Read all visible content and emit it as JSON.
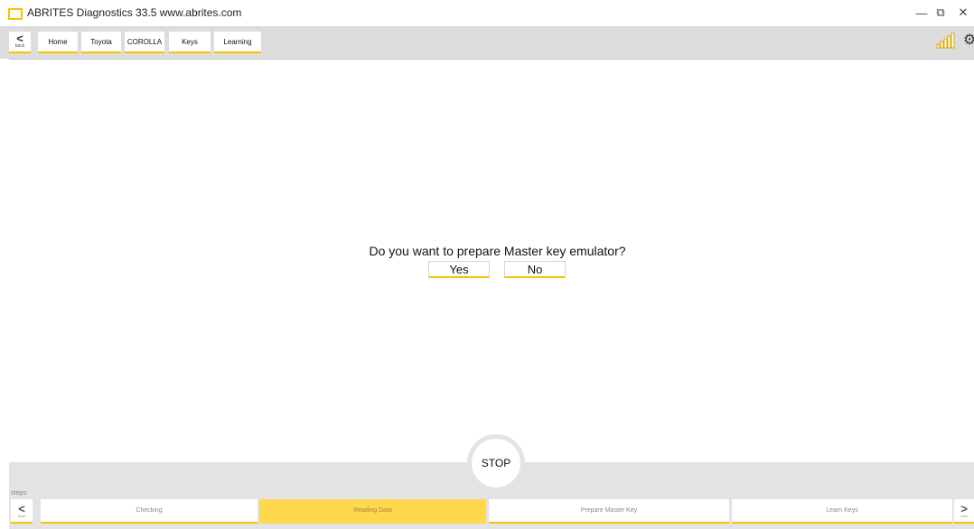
{
  "window": {
    "title": "ABRITES Diagnostics 33.5   www.abrites.com",
    "minimize": "—",
    "restore": "⧉",
    "close": "✕"
  },
  "nav": {
    "back_label": "back",
    "breadcrumbs": [
      "Home",
      "Toyota",
      "COROLLA",
      "Keys",
      "Learning"
    ]
  },
  "dialog": {
    "question": "Do you want to prepare Master key emulator?",
    "yes_label": "Yes",
    "no_label": "No"
  },
  "stop_label": "STOP",
  "steps": {
    "label": "steps:",
    "back_label": "back",
    "next_label": "next",
    "items": [
      {
        "label": "Checking",
        "active": false
      },
      {
        "label": "Reading Data",
        "active": true
      },
      {
        "label": "Prepare Master Key",
        "active": false
      },
      {
        "label": "Learn Keys",
        "active": false
      }
    ]
  },
  "colors": {
    "accent": "#f7c400",
    "active_step": "#ffd84d",
    "toolbar": "#dcdcdc"
  }
}
